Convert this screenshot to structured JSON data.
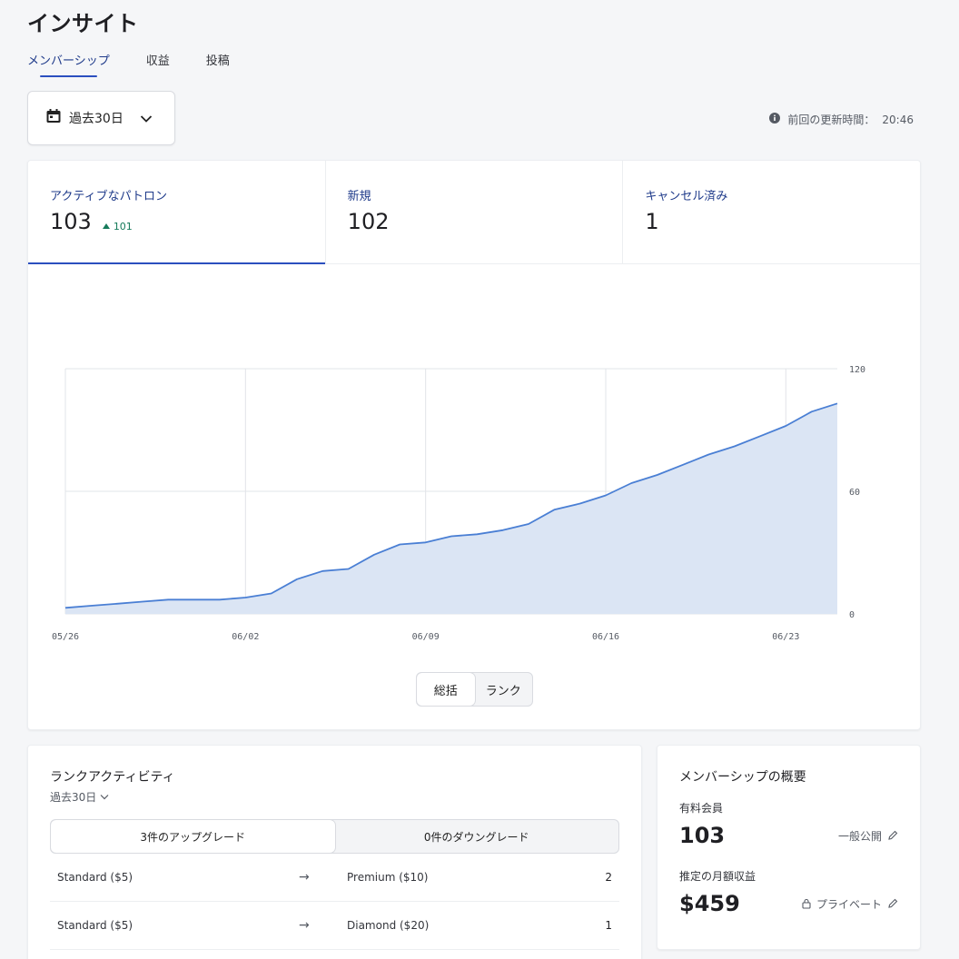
{
  "page": {
    "title": "インサイト"
  },
  "tabs": [
    {
      "label": "メンバーシップ",
      "active": true
    },
    {
      "label": "収益",
      "active": false
    },
    {
      "label": "投稿",
      "active": false
    }
  ],
  "date_filter": {
    "label": "過去30日",
    "icon": "calendar-icon"
  },
  "last_updated": {
    "label": "前回の更新時間：",
    "time": "20:46"
  },
  "metrics": [
    {
      "label": "アクティブなパトロン",
      "value": "103",
      "delta": "101"
    },
    {
      "label": "新規",
      "value": "102"
    },
    {
      "label": "キャンセル済み",
      "value": "1"
    }
  ],
  "chart_data": {
    "type": "area",
    "x": [
      "05/26",
      "05/27",
      "05/28",
      "05/29",
      "05/30",
      "05/31",
      "06/01",
      "06/02",
      "06/03",
      "06/04",
      "06/05",
      "06/06",
      "06/07",
      "06/08",
      "06/09",
      "06/10",
      "06/11",
      "06/12",
      "06/13",
      "06/14",
      "06/15",
      "06/16",
      "06/17",
      "06/18",
      "06/19",
      "06/20",
      "06/21",
      "06/22",
      "06/23",
      "06/24",
      "06/25"
    ],
    "series": [
      {
        "values": [
          3,
          4,
          5,
          6,
          7,
          7,
          7,
          8,
          10,
          17,
          21,
          22,
          29,
          34,
          35,
          38,
          39,
          41,
          44,
          51,
          54,
          58,
          64,
          68,
          73,
          78,
          82,
          87,
          92,
          99,
          103
        ]
      }
    ],
    "xticks": [
      "05/26",
      "06/02",
      "06/09",
      "06/16",
      "06/23"
    ],
    "yticks": [
      "120",
      "60",
      "0"
    ],
    "ylim": [
      0,
      120
    ],
    "grid": true,
    "color": "#4a7fd4",
    "fill": "#dbe5f4"
  },
  "chart_toggle": [
    {
      "label": "総括",
      "active": true
    },
    {
      "label": "ランク",
      "active": false
    }
  ],
  "rank_activity": {
    "title": "ランクアクティビティ",
    "period": "過去30日",
    "upgrades_label": "3件のアップグレード",
    "downgrades_label": "0件のダウングレード",
    "rows": [
      {
        "from": "Standard ($5)",
        "to": "Premium ($10)",
        "count": "2"
      },
      {
        "from": "Standard ($5)",
        "to": "Diamond ($20)",
        "count": "1"
      }
    ]
  },
  "summary": {
    "title": "メンバーシップの概要",
    "paid_label": "有料会員",
    "paid_value": "103",
    "paid_visibility": "一般公開",
    "revenue_label": "推定の月額収益",
    "revenue_value": "$459",
    "revenue_visibility": "プライベート"
  }
}
